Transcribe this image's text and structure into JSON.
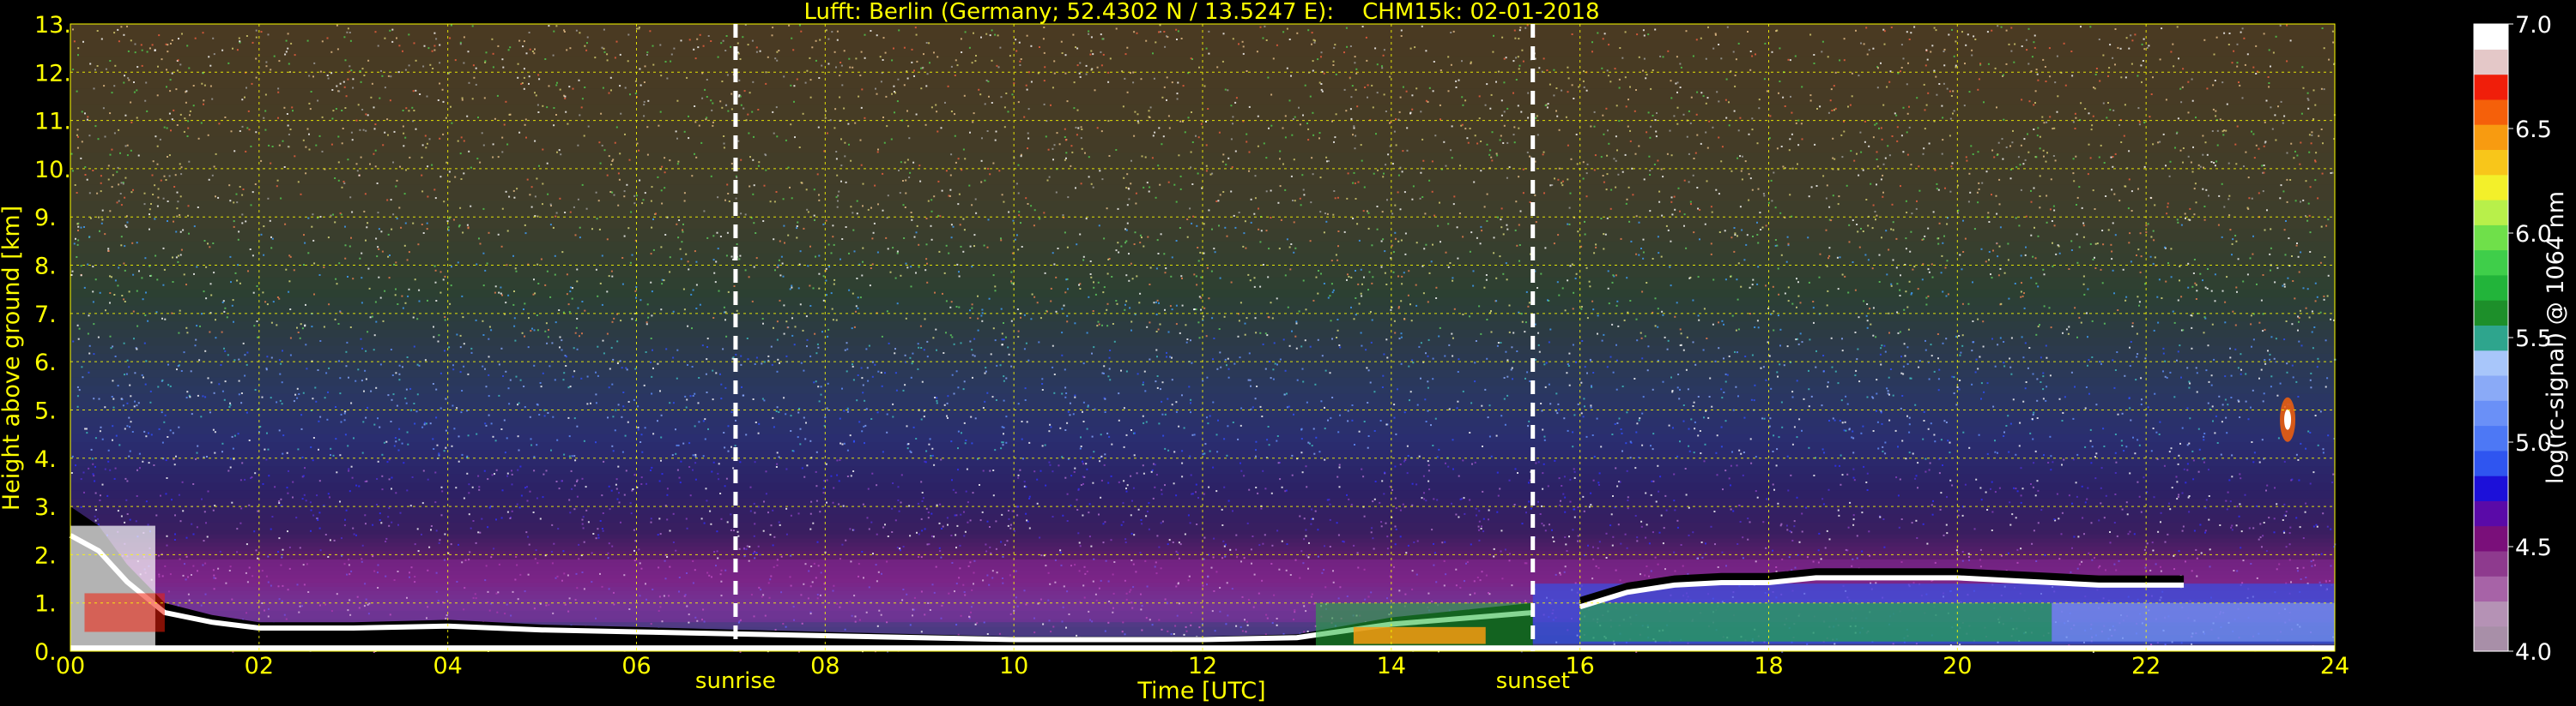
{
  "chart_data": {
    "type": "heatmap",
    "title": "Lufft: Berlin (Germany; 52.4302 N / 13.5247 E):    CHM15k: 02-01-2018",
    "xlabel": "Time [UTC]",
    "ylabel": "Height above ground [km]",
    "colorbar_label": "log(rc-signal) @ 1064 nm",
    "xlim": [
      0,
      24
    ],
    "ylim": [
      0,
      13
    ],
    "x_ticks": [
      0,
      2,
      4,
      6,
      8,
      10,
      12,
      14,
      16,
      18,
      20,
      22,
      24
    ],
    "x_tick_labels": [
      "00",
      "02",
      "04",
      "06",
      "08",
      "10",
      "12",
      "14",
      "16",
      "18",
      "20",
      "22",
      "24"
    ],
    "y_ticks": [
      0,
      1,
      2,
      3,
      4,
      5,
      6,
      7,
      8,
      9,
      10,
      11,
      12,
      13
    ],
    "y_tick_labels": [
      "0.",
      "1.",
      "2.",
      "3.",
      "4.",
      "5.",
      "6.",
      "7.",
      "8.",
      "9.",
      "10.",
      "11.",
      "12.",
      "13."
    ],
    "colorbar_range": [
      4.0,
      7.0
    ],
    "colorbar_ticks": [
      4.0,
      4.5,
      5.0,
      5.5,
      6.0,
      6.5,
      7.0
    ],
    "colorbar_tick_labels": [
      "4.0",
      "4.5",
      "5.0",
      "5.5",
      "6.0",
      "6.5",
      "7.0"
    ],
    "grid": true,
    "markers": [
      {
        "label": "sunrise",
        "time": 7.05
      },
      {
        "label": "sunset",
        "time": 15.5
      }
    ],
    "cloud_layer": {
      "description": "boundary-layer cloud top (white/black band)",
      "points": [
        [
          16.0,
          1.0
        ],
        [
          16.5,
          1.3
        ],
        [
          17.0,
          1.45
        ],
        [
          17.5,
          1.5
        ],
        [
          18.0,
          1.5
        ],
        [
          18.5,
          1.6
        ],
        [
          19.0,
          1.6
        ],
        [
          19.5,
          1.6
        ],
        [
          20.0,
          1.6
        ],
        [
          20.5,
          1.55
        ],
        [
          21.0,
          1.5
        ],
        [
          21.5,
          1.45
        ],
        [
          22.0,
          1.45
        ],
        [
          22.4,
          1.45
        ]
      ]
    },
    "boundary_layer": {
      "description": "aerosol / mixing layer top",
      "points": [
        [
          0.0,
          3.0
        ],
        [
          0.3,
          2.6
        ],
        [
          0.6,
          1.8
        ],
        [
          1.0,
          1.0
        ],
        [
          1.5,
          0.75
        ],
        [
          2.0,
          0.6
        ],
        [
          3.0,
          0.6
        ],
        [
          4.0,
          0.65
        ],
        [
          5.0,
          0.55
        ],
        [
          6.0,
          0.5
        ],
        [
          7.0,
          0.45
        ],
        [
          8.0,
          0.4
        ],
        [
          9.0,
          0.35
        ],
        [
          10.0,
          0.3
        ],
        [
          11.0,
          0.3
        ],
        [
          12.0,
          0.3
        ],
        [
          13.0,
          0.35
        ],
        [
          14.0,
          0.7
        ],
        [
          15.0,
          0.9
        ],
        [
          15.5,
          1.0
        ]
      ]
    },
    "elevated_feature": {
      "time": 23.5,
      "height": 4.8
    }
  },
  "colors": {
    "background": "#000000",
    "tick_text": "#ffff00",
    "grid": "#ffff00",
    "colorbar_text": "#ffffff",
    "marker_line": "#ffffff"
  },
  "colormap": [
    "#a88fa8",
    "#b592b5",
    "#a763a7",
    "#8e3a8e",
    "#7a0f7a",
    "#5a0aa8",
    "#1c10d9",
    "#2f55f0",
    "#4d78f5",
    "#6a90f7",
    "#8aaaf7",
    "#a8c6fa",
    "#2ea58d",
    "#1d8f2a",
    "#22b43a",
    "#3fce4a",
    "#6fe04a",
    "#b8f04a",
    "#f3f02a",
    "#f8c61a",
    "#f89b10",
    "#f5600a",
    "#f01e0a",
    "#e4c8c8",
    "#ffffff"
  ]
}
